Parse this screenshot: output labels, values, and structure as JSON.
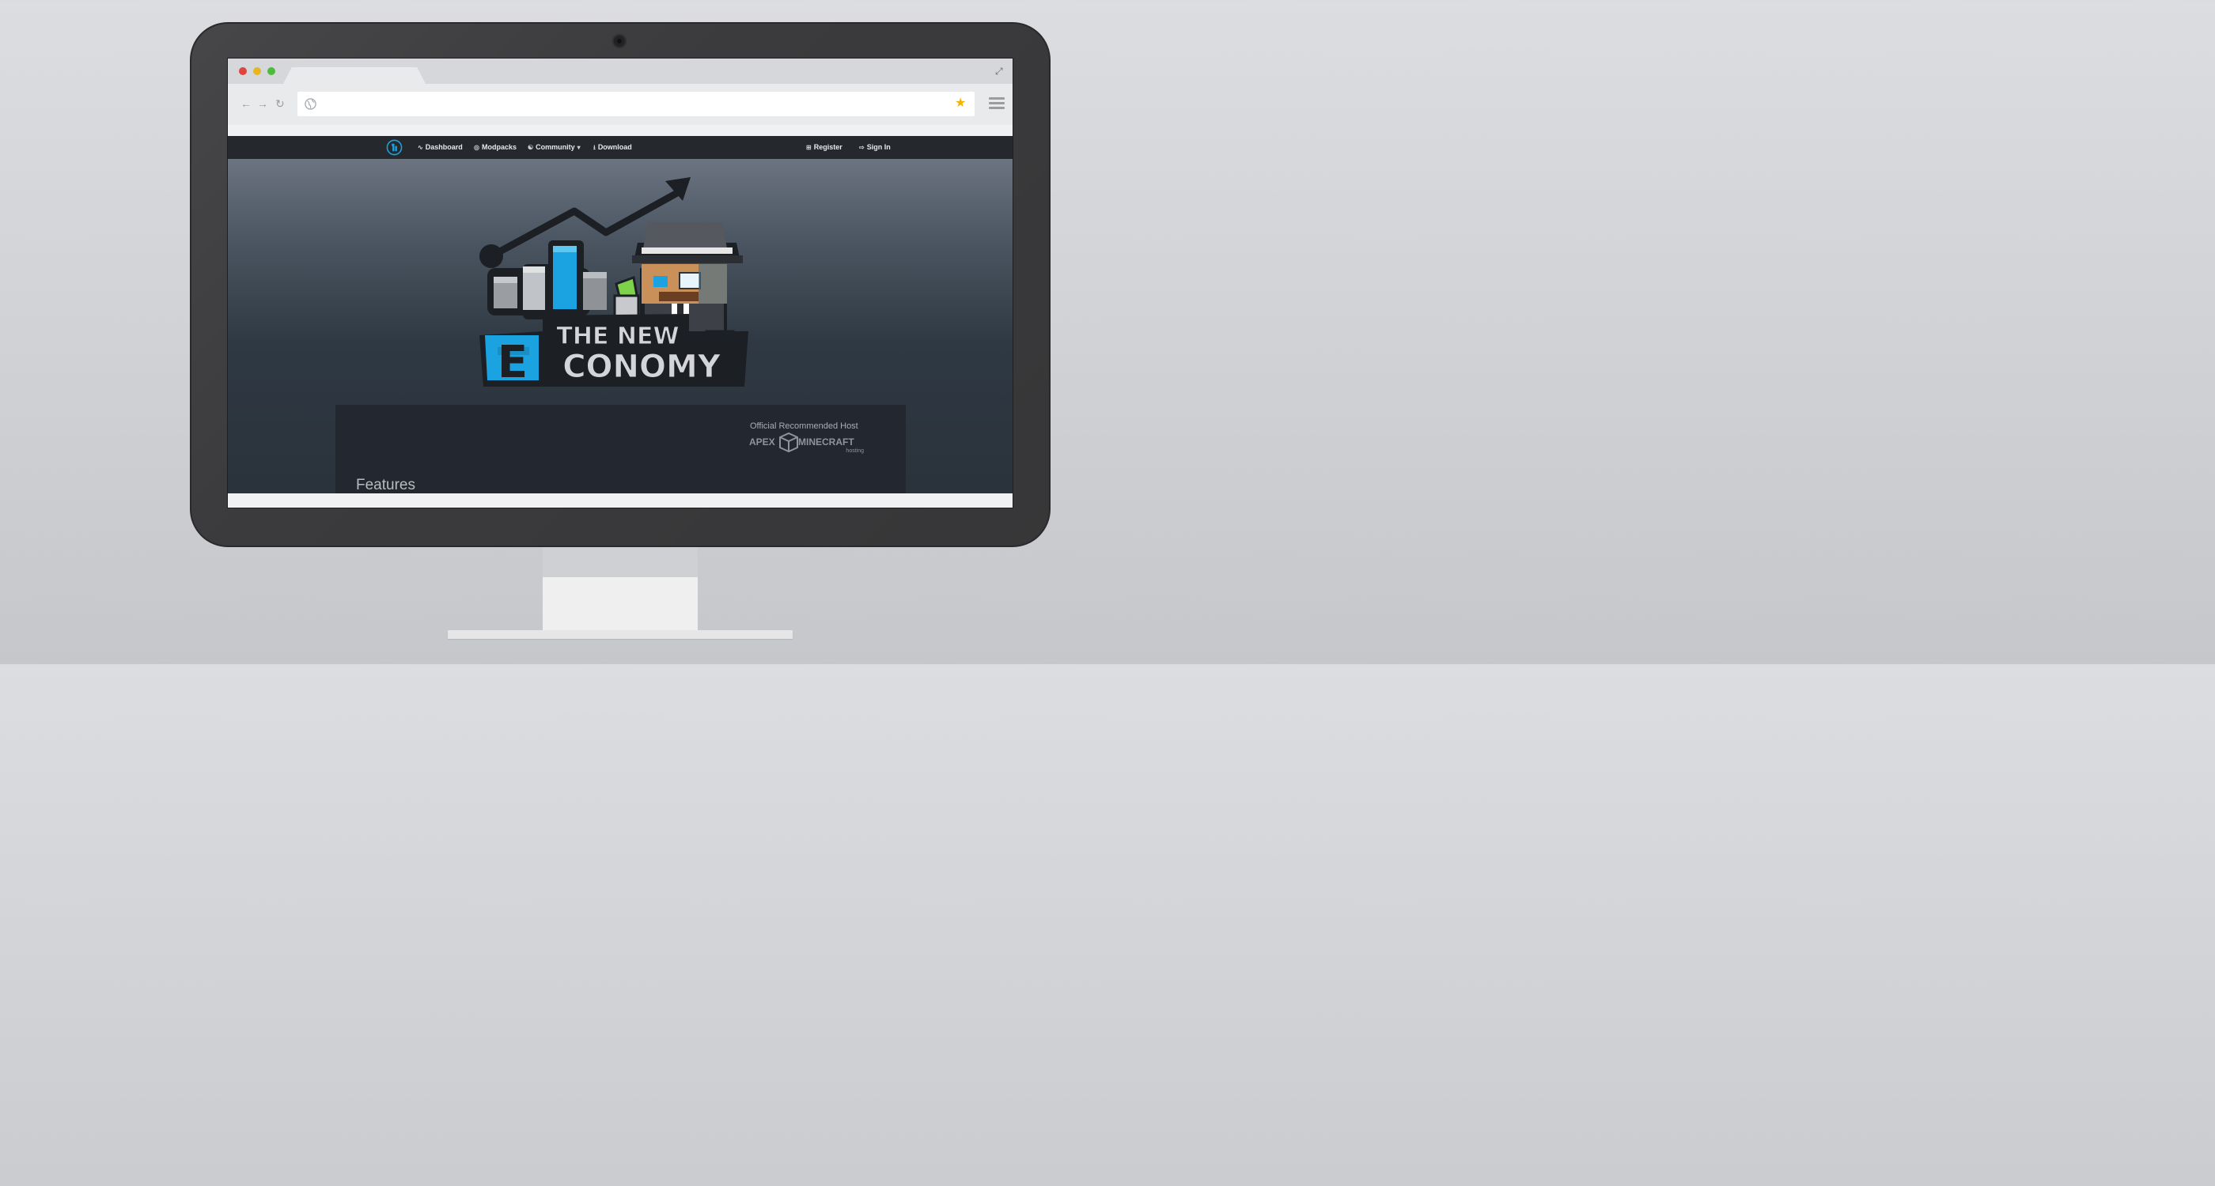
{
  "browser": {
    "window_buttons": [
      {
        "name": "close",
        "color": "#e0443e"
      },
      {
        "name": "minimize",
        "color": "#e6b622"
      },
      {
        "name": "maximize",
        "color": "#4cbc3c"
      }
    ],
    "address": "",
    "icons": {
      "back": "arrow-left-icon",
      "forward": "arrow-right-icon",
      "reload": "reload-icon",
      "site": "globe-icon",
      "bookmark": "star-icon",
      "menu": "hamburger-menu-icon",
      "fullscreen": "expand-icon"
    },
    "bookmark_color": "#f1b400"
  },
  "site": {
    "nav": {
      "logo_icon": "site-logo-icon",
      "items": [
        {
          "label": "Dashboard",
          "icon": "rss-icon"
        },
        {
          "label": "Modpacks",
          "icon": "dashboard-icon"
        },
        {
          "label": "Community",
          "icon": "users-icon",
          "dropdown": true
        },
        {
          "label": "Download",
          "icon": "download-icon"
        }
      ],
      "right_items": [
        {
          "label": "Register",
          "icon": "plus-square-icon"
        },
        {
          "label": "Sign In",
          "icon": "sign-in-icon"
        }
      ]
    },
    "hero": {
      "logo_text_line1": "THE NEW",
      "logo_text_line2": "CONOMY",
      "logo_letter": "E",
      "accent": "#1aa3e0"
    },
    "host": {
      "label": "Official Recommended Host",
      "brand_left": "APEX",
      "brand_right": "MINECRAFT",
      "brand_sub": "hosting"
    },
    "features_heading": "Features"
  }
}
